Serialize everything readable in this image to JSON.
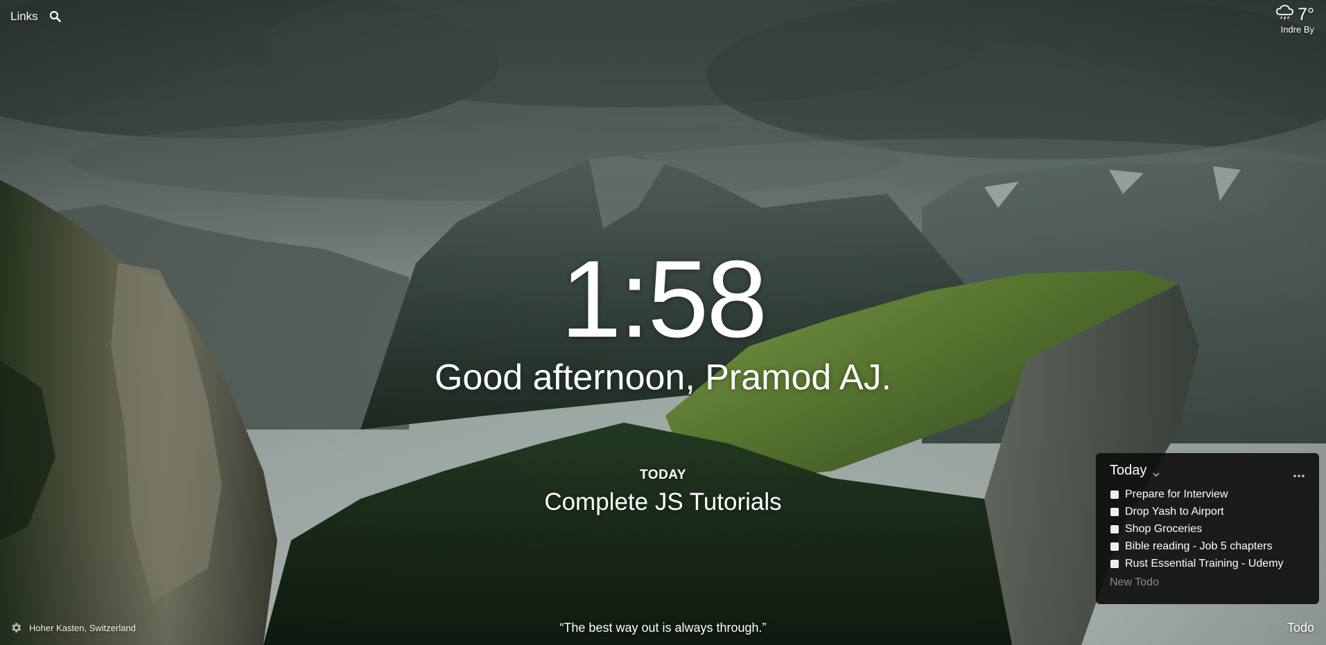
{
  "topbar": {
    "links_label": "Links",
    "search_icon": "search-icon"
  },
  "weather": {
    "icon": "cloud-rain-icon",
    "temperature": "7°",
    "location": "Indre By"
  },
  "main": {
    "time": "1:58",
    "greeting": "Good afternoon, Pramod AJ.",
    "focus_label": "TODAY",
    "focus_text": "Complete JS Tutorials"
  },
  "footer": {
    "settings_icon": "gear-icon",
    "photo_location": "Hoher Kasten, Switzerland",
    "quote": "“The best way out is always through.”",
    "todo_label": "Todo"
  },
  "todo": {
    "list_name": "Today",
    "items": [
      {
        "text": "Prepare for Interview",
        "done": false
      },
      {
        "text": "Drop Yash to Airport",
        "done": false
      },
      {
        "text": "Shop Groceries",
        "done": false
      },
      {
        "text": "Bible reading - Job 5 chapters",
        "done": false
      },
      {
        "text": "Rust Essential Training - Udemy",
        "done": false
      }
    ],
    "new_placeholder": "New Todo"
  },
  "colors": {
    "panel_bg": "#0f0f0f",
    "text": "#ffffff",
    "muted": "#8a8a8a"
  }
}
